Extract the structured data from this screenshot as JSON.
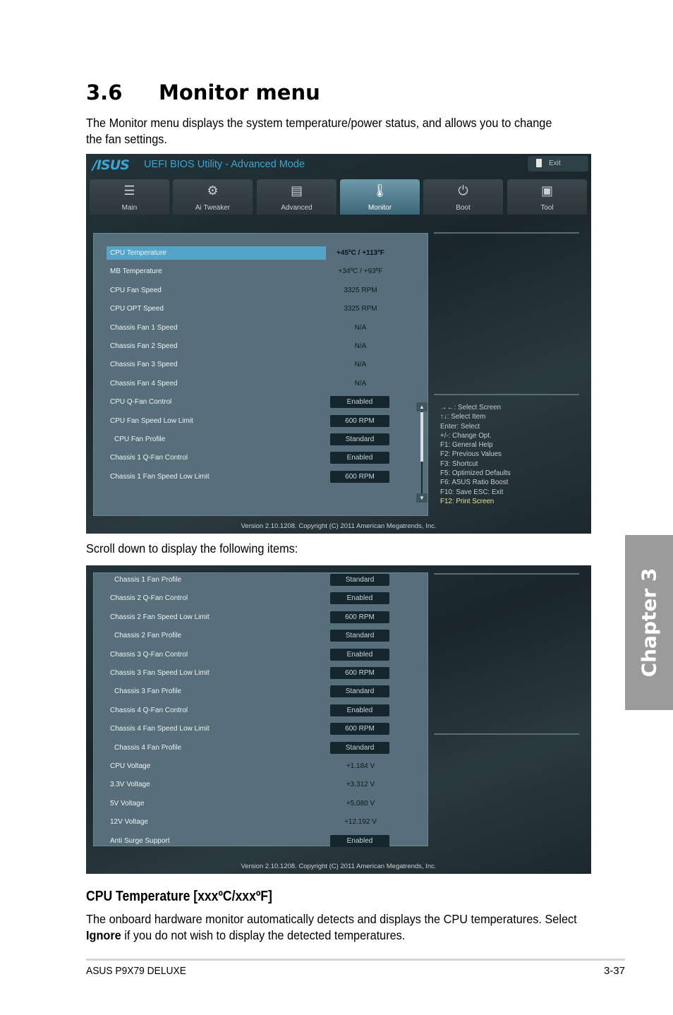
{
  "page": {
    "section_number": "3.6",
    "section_title": "Monitor menu",
    "intro": "The Monitor menu displays the system temperature/power status, and allows you to change the fan settings.",
    "scroll_note": "Scroll down to display the following items:",
    "subsection_title": "CPU Temperature [xxxºC/xxxºF]",
    "description_pre": "The onboard hardware monitor automatically detects and displays the CPU temperatures. Select ",
    "description_bold": "Ignore",
    "description_post": " if you do not wish to display the detected temperatures.",
    "footer_left": "ASUS P9X79 DELUXE",
    "footer_right": "3-37",
    "chapter_tab": "Chapter 3"
  },
  "bios": {
    "logo": "/ISUS",
    "title": "UEFI BIOS Utility - Advanced Mode",
    "exit_label": "Exit",
    "tabs": [
      {
        "label": "Main",
        "icon": "list-icon",
        "glyph": "☰"
      },
      {
        "label": "Ai  Tweaker",
        "icon": "tweaker-icon",
        "glyph": "⚙"
      },
      {
        "label": "Advanced",
        "icon": "advanced-icon",
        "glyph": "▤"
      },
      {
        "label": "Monitor",
        "icon": "thermometer-icon",
        "glyph": "🌡"
      },
      {
        "label": "Boot",
        "icon": "power-icon",
        "glyph": "⏻"
      },
      {
        "label": "Tool",
        "icon": "toolbox-icon",
        "glyph": "▣"
      }
    ],
    "active_tab": "Monitor",
    "screen1_items": [
      {
        "label": "CPU Temperature",
        "value": "+45ºC / +113ºF",
        "type": "text",
        "selected": true
      },
      {
        "label": "MB Temperature",
        "value": "+34ºC / +93ºF",
        "type": "text"
      },
      {
        "label": "CPU Fan Speed",
        "value": "3325 RPM",
        "type": "text"
      },
      {
        "label": "CPU OPT Speed",
        "value": "3325 RPM",
        "type": "text"
      },
      {
        "label": "Chassis Fan 1 Speed",
        "value": "N/A",
        "type": "text"
      },
      {
        "label": "Chassis Fan 2 Speed",
        "value": "N/A",
        "type": "text"
      },
      {
        "label": "Chassis Fan 3 Speed",
        "value": "N/A",
        "type": "text"
      },
      {
        "label": "Chassis Fan 4 Speed",
        "value": "N/A",
        "type": "text"
      },
      {
        "label": "CPU Q-Fan Control",
        "value": "Enabled",
        "type": "button"
      },
      {
        "label": "CPU Fan Speed Low Limit",
        "value": "600 RPM",
        "type": "button"
      },
      {
        "label": "CPU Fan Profile",
        "value": "Standard",
        "type": "button",
        "indent": true
      },
      {
        "label": "Chassis 1 Q-Fan Control",
        "value": "Enabled",
        "type": "button"
      },
      {
        "label": "Chassis 1 Fan Speed Low Limit",
        "value": "600 RPM",
        "type": "button"
      }
    ],
    "screen2_items": [
      {
        "label": "Chassis 1 Fan Profile",
        "value": "Standard",
        "type": "button",
        "indent": true
      },
      {
        "label": "Chassis 2 Q-Fan Control",
        "value": "Enabled",
        "type": "button"
      },
      {
        "label": "Chassis 2 Fan Speed Low Limit",
        "value": "600 RPM",
        "type": "button"
      },
      {
        "label": "Chassis 2 Fan Profile",
        "value": "Standard",
        "type": "button",
        "indent": true
      },
      {
        "label": "Chassis 3 Q-Fan Control",
        "value": "Enabled",
        "type": "button"
      },
      {
        "label": "Chassis 3 Fan Speed Low Limit",
        "value": "600 RPM",
        "type": "button"
      },
      {
        "label": "Chassis 3 Fan Profile",
        "value": "Standard",
        "type": "button",
        "indent": true
      },
      {
        "label": "Chassis 4 Q-Fan Control",
        "value": "Enabled",
        "type": "button"
      },
      {
        "label": "Chassis 4 Fan Speed Low Limit",
        "value": "600 RPM",
        "type": "button"
      },
      {
        "label": "Chassis 4 Fan Profile",
        "value": "Standard",
        "type": "button",
        "indent": true
      },
      {
        "label": "CPU Voltage",
        "value": "+1.184 V",
        "type": "text"
      },
      {
        "label": "3.3V Voltage",
        "value": "+3.312 V",
        "type": "text"
      },
      {
        "label": "5V Voltage",
        "value": "+5.080 V",
        "type": "text"
      },
      {
        "label": "12V Voltage",
        "value": "+12.192 V",
        "type": "text"
      },
      {
        "label": "Anti Surge Support",
        "value": "Enabled",
        "type": "button"
      }
    ],
    "help_keys": [
      "→←:  Select Screen",
      "↑↓:  Select Item",
      "Enter:  Select",
      "+/-:  Change Opt.",
      "F1:  General Help",
      "F2:  Previous Values",
      "F3:  Shortcut",
      "F5:  Optimized Defaults",
      "F6:  ASUS Ratio Boost",
      "F10:  Save    ESC:  Exit",
      "F12:  Print Screen"
    ],
    "scroll_up_glyph": "▲",
    "scroll_down_glyph": "▼",
    "version": "Version  2.10.1208.  Copyright  (C)  2011  American  Megatrends,  Inc.",
    "colors": {
      "accent": "#3fa4cf",
      "selected_row": "#55a5c8",
      "panel": "#566f7a",
      "f12_highlight": "#e8e28e"
    }
  }
}
